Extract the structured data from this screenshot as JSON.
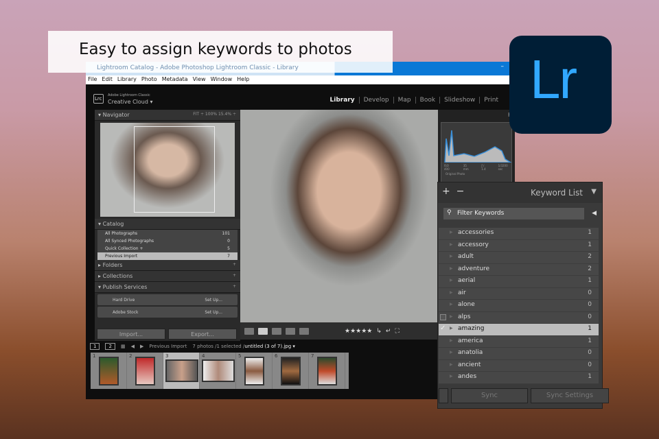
{
  "caption": "Easy to assign keywords to photos",
  "logo_text": "Lr",
  "window": {
    "title": "Lightroom Catalog - Adobe Photoshop Lightroom Classic - Library",
    "minimize": "–"
  },
  "menu": [
    "File",
    "Edit",
    "Library",
    "Photo",
    "Metadata",
    "View",
    "Window",
    "Help"
  ],
  "brand": {
    "badge": "Lrc",
    "line1": "Adobe Lightroom Classic",
    "line2": "Creative Cloud ▾"
  },
  "modules": [
    "Library",
    "Develop",
    "Map",
    "Book",
    "Slideshow",
    "Print"
  ],
  "navigator": {
    "title": "Navigator",
    "zoom": "FIT ÷   100%   15.4% ÷"
  },
  "catalog": {
    "title": "Catalog",
    "items": [
      {
        "label": "All Photographs",
        "count": "101"
      },
      {
        "label": "All Synced Photographs",
        "count": "0"
      },
      {
        "label": "Quick Collection +",
        "count": "5"
      },
      {
        "label": "Previous Import",
        "count": "7"
      }
    ]
  },
  "panels": {
    "folders": "Folders",
    "collections": "Collections",
    "publish": "Publish Services",
    "add": "+"
  },
  "publish_services": [
    {
      "label": "Hard Drive",
      "action": "Set Up..."
    },
    {
      "label": "Adobe Stock",
      "action": "Set Up..."
    }
  ],
  "buttons": {
    "import": "Import...",
    "export": "Export..."
  },
  "toolbar": {
    "stars": "★★★★★"
  },
  "histogram": {
    "title": "H",
    "iso": "ISO 400",
    "focal": "35 mm",
    "aperture": "ƒ / 1.4",
    "shutter": "1/3200 sec",
    "original": "Original Photo"
  },
  "filmstrip": {
    "page1": "1",
    "page2": "2",
    "source": "Previous Import",
    "info": "7 photos /1 selected /",
    "file": "untitled (3 of 7).jpg ▾",
    "items": [
      "1",
      "2",
      "3",
      "4",
      "5",
      "6",
      "7"
    ],
    "selected": 3
  },
  "keyword_list": {
    "title": "Keyword List",
    "plus": "+",
    "minus": "−",
    "filter_placeholder": "Filter Keywords",
    "items": [
      {
        "k": "accessories",
        "n": "1"
      },
      {
        "k": "accessory",
        "n": "1"
      },
      {
        "k": "adult",
        "n": "2"
      },
      {
        "k": "adventure",
        "n": "2"
      },
      {
        "k": "aerial",
        "n": "1"
      },
      {
        "k": "air",
        "n": "0"
      },
      {
        "k": "alone",
        "n": "0"
      },
      {
        "k": "alps",
        "n": "0"
      },
      {
        "k": "amazing",
        "n": "1"
      },
      {
        "k": "america",
        "n": "1"
      },
      {
        "k": "anatolia",
        "n": "0"
      },
      {
        "k": "ancient",
        "n": "0"
      },
      {
        "k": "andes",
        "n": "1"
      }
    ],
    "selected": "amazing",
    "sync": "Sync",
    "sync_settings": "Sync Settings"
  }
}
